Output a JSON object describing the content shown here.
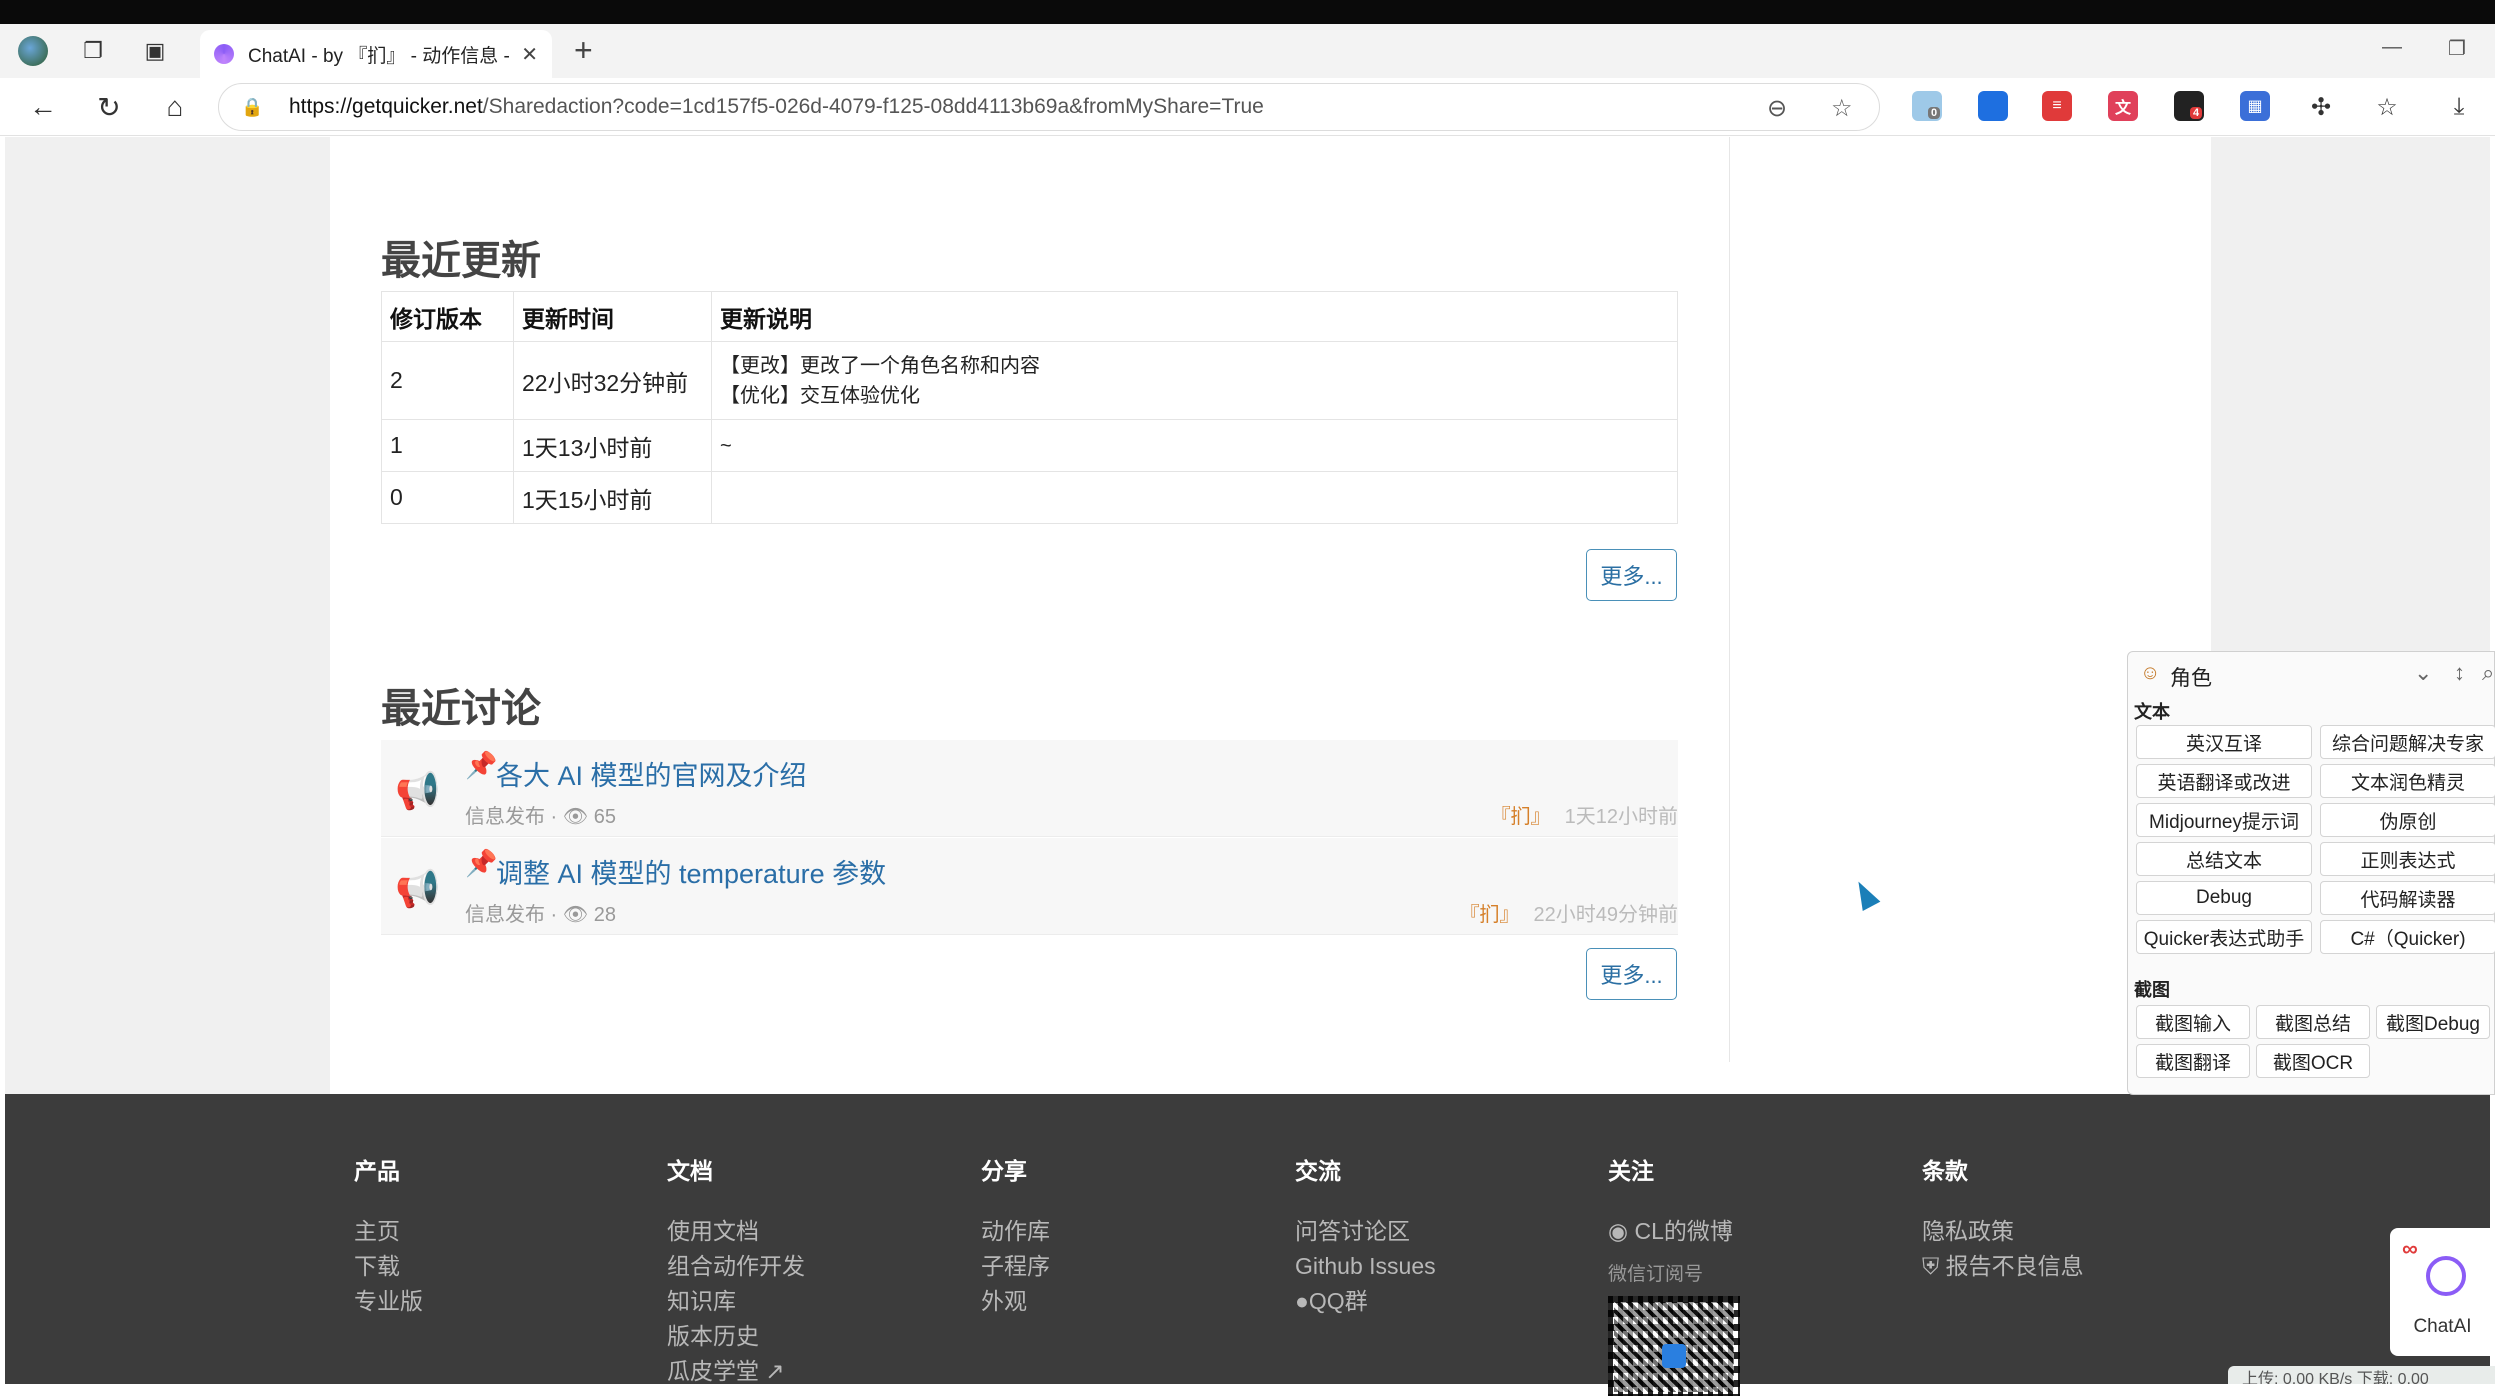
{
  "browser": {
    "tab_title": "ChatAI - by 『扪』 - 动作信息 - Q",
    "url_host": "https://getquicker.net",
    "url_path": "/Sharedaction?code=1cd157f5-026d-4079-f125-08dd4113b69a&fromMyShare=True",
    "extension_badges": [
      "0",
      "4"
    ]
  },
  "updates": {
    "title": "最近更新",
    "headers": [
      "修订版本",
      "更新时间",
      "更新说明"
    ],
    "rows": [
      {
        "version": "2",
        "time": "22小时32分钟前",
        "note1": "【更改】更改了一个角色名称和内容",
        "note2": "【优化】交互体验优化"
      },
      {
        "version": "1",
        "time": "1天13小时前",
        "note1": "~",
        "note2": ""
      },
      {
        "version": "0",
        "time": "1天15小时前",
        "note1": "",
        "note2": ""
      }
    ],
    "more": "更多..."
  },
  "discussions": {
    "title": "最近讨论",
    "items": [
      {
        "title": "各大 AI 模型的官网及介绍",
        "category": "信息发布",
        "views": "65",
        "author": "『扪』",
        "time": "1天12小时前"
      },
      {
        "title": "调整 AI 模型的 temperature 参数",
        "category": "信息发布",
        "views": "28",
        "author": "『扪』",
        "time": "22小时49分钟前"
      }
    ],
    "more": "更多..."
  },
  "footer": {
    "product": {
      "title": "产品",
      "links": [
        "主页",
        "下载",
        "专业版"
      ]
    },
    "docs": {
      "title": "文档",
      "links": [
        "使用文档",
        "组合动作开发",
        "知识库",
        "版本历史",
        "瓜皮学堂"
      ]
    },
    "share": {
      "title": "分享",
      "links": [
        "动作库",
        "子程序",
        "外观"
      ]
    },
    "community": {
      "title": "交流",
      "links": [
        "问答讨论区",
        "Github Issues",
        "QQ群"
      ]
    },
    "follow": {
      "title": "关注",
      "weibo": "CL的微博",
      "wechat": "微信订阅号"
    },
    "terms": {
      "title": "条款",
      "links": [
        "隐私政策",
        "报告不良信息"
      ]
    }
  },
  "role_panel": {
    "title": "角色",
    "text_group": "文本",
    "text_buttons": [
      "英汉互译",
      "综合问题解决专家",
      "英语翻译或改进",
      "文本润色精灵",
      "Midjourney提示词",
      "伪原创",
      "总结文本",
      "正则表达式",
      "Debug",
      "代码解读器",
      "Quicker表达式助手",
      "C#（Quicker)"
    ],
    "screenshot_group": "截图",
    "screenshot_buttons": [
      "截图输入",
      "截图总结",
      "截图Debug",
      "截图翻译",
      "截图OCR"
    ]
  },
  "chatai_widget": {
    "label": "ChatAI"
  },
  "netbar": {
    "text": "上传: 0.00 KB/s 下载: 0.00"
  }
}
